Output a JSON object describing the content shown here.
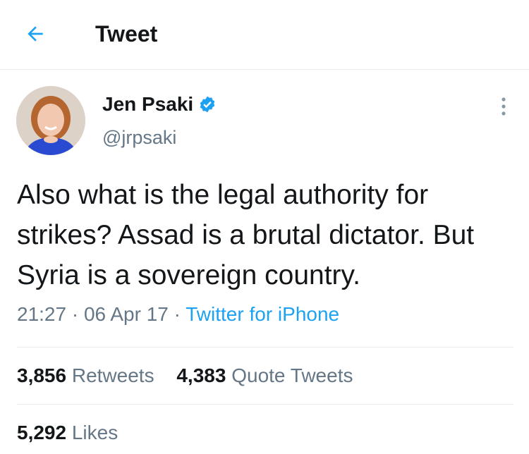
{
  "header": {
    "title": "Tweet",
    "back_icon": "arrow-left-icon",
    "accent_color": "#1da1f2"
  },
  "author": {
    "name": "Jen Psaki",
    "handle": "@jrpsaki",
    "verified_icon": "verified-badge-icon"
  },
  "tweet": {
    "text": "Also what is the legal authority for strikes? Assad is a brutal dictator. But Syria is a sovereign country.",
    "time": "21:27",
    "date": "06 Apr 17",
    "separator": "·",
    "source": "Twitter for iPhone"
  },
  "stats": {
    "retweets_count": "3,856",
    "retweets_label": "Retweets",
    "quotes_count": "4,383",
    "quotes_label": "Quote Tweets",
    "likes_count": "5,292",
    "likes_label": "Likes"
  }
}
